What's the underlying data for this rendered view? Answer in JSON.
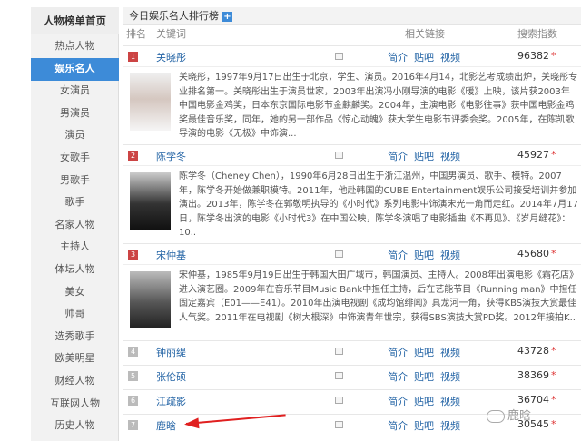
{
  "sidebar": {
    "header": "人物榜单首页",
    "items": [
      {
        "label": "热点人物"
      },
      {
        "label": "娱乐名人",
        "active": true
      },
      {
        "label": "女演员"
      },
      {
        "label": "男演员"
      },
      {
        "label": "演员"
      },
      {
        "label": "女歌手"
      },
      {
        "label": "男歌手"
      },
      {
        "label": "歌手"
      },
      {
        "label": "名家人物"
      },
      {
        "label": "主持人"
      },
      {
        "label": "体坛人物"
      },
      {
        "label": "美女"
      },
      {
        "label": "帅哥"
      },
      {
        "label": "选秀歌手"
      },
      {
        "label": "欧美明星"
      },
      {
        "label": "财经人物"
      },
      {
        "label": "互联网人物"
      },
      {
        "label": "历史人物"
      }
    ]
  },
  "main": {
    "title": "今日娱乐名人排行榜",
    "plus_icon": "+",
    "headers": {
      "rank": "排名",
      "keyword": "关键词",
      "links": "相关链接",
      "index": "搜索指数"
    },
    "link_labels": [
      "简介",
      "贴吧",
      "视频"
    ],
    "rows": [
      {
        "rank": "1",
        "name": "关晓彤",
        "score": "96382",
        "desc": "关晓彤，1997年9月17日出生于北京，学生、演员。2016年4月14，北影艺考成绩出炉，关晓彤专业排名第一。关晓彤出生于演员世家，2003年出演冯小刚导演的电影《暖》上映，该片获2003年中国电影金鸡奖，日本东京国际电影节金麒麟奖。2004年，主演电影《电影往事》获中国电影金鸡奖最佳音乐奖，同年，她的另一部作品《惊心动魄》获大学生电影节评委会奖。2005年，在陈凯歌导演的电影《无极》中饰演..."
      },
      {
        "rank": "2",
        "name": "陈学冬",
        "score": "45927",
        "desc": "陈学冬（Cheney Chen），1990年6月28日出生于浙江温州，中国男演员、歌手、模特。2007年，陈学冬开始做兼职模特。2011年，他赴韩国的CUBE Entertainment娱乐公司接受培训并参加演出。2013年，陈学冬在郭敬明执导的《小时代》系列电影中饰演宋光一角而走红。2014年7月17日，陈学冬出演的电影《小时代3》在中国公映，陈学冬演唱了电影插曲《不再见》、《岁月缝花》：10.."
      },
      {
        "rank": "3",
        "name": "宋仲基",
        "score": "45680",
        "desc": "宋仲基，1985年9月19日出生于韩国大田广域市，韩国演员、主持人。2008年出演电影《霜花店》进入演艺圈。2009年在音乐节目Music Bank中担任主持，后在艺能节目《Running man》中担任固定嘉宾（E01——E41）。2010年出演电视剧《成均馆绯闻》具龙河一角，获得KBS演技大赏最佳人气奖。2011年在电视剧《树大根深》中饰演青年世宗，获得SBS演技大赏PD奖。2012年接拍K.."
      },
      {
        "rank": "4",
        "name": "钟丽缇",
        "score": "43728"
      },
      {
        "rank": "5",
        "name": "张伦硕",
        "score": "38369"
      },
      {
        "rank": "6",
        "name": "江疏影",
        "score": "36704"
      },
      {
        "rank": "7",
        "name": "鹿晗",
        "score": "30545"
      }
    ]
  },
  "watermark": "鹿晗",
  "colors": {
    "accent": "#3d8bd8",
    "link": "#2565a6",
    "rank_top": "#cc4444",
    "arrow": "#e02020"
  }
}
